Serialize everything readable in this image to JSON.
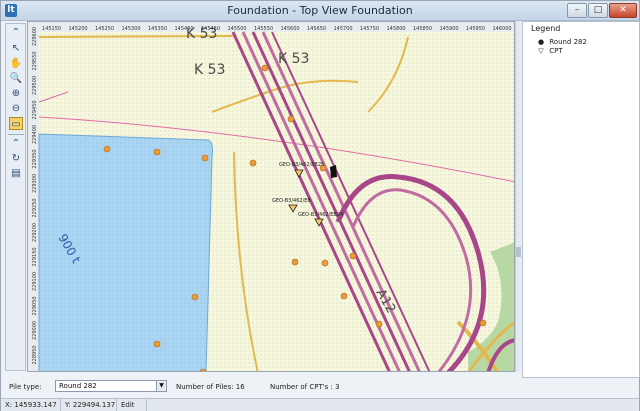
{
  "window": {
    "title": "Foundation - Top View Foundation",
    "app_icon": "app-icon"
  },
  "window_buttons": {
    "minimize": "–",
    "maximize": "□",
    "close": "✕"
  },
  "toolbar": {
    "tools": [
      {
        "name": "collapse-up-icon",
        "glyph": "⌃"
      },
      {
        "name": "select-arrow-icon",
        "glyph": "↖"
      },
      {
        "name": "pan-hand-icon",
        "glyph": "✋"
      },
      {
        "name": "zoom-in-icon",
        "glyph": "🔍"
      },
      {
        "name": "zoom-window-icon",
        "glyph": "⊕"
      },
      {
        "name": "zoom-out-icon",
        "glyph": "⊖"
      },
      {
        "name": "zoom-extent-icon",
        "glyph": "▭"
      },
      {
        "name": "collapse-up-icon-2",
        "glyph": "⌃"
      },
      {
        "name": "redraw-icon",
        "glyph": "↻"
      },
      {
        "name": "properties-icon",
        "glyph": "▤"
      }
    ]
  },
  "ruler_top": [
    "145150",
    "145200",
    "145250",
    "145300",
    "145350",
    "145400",
    "145450",
    "145500",
    "145550",
    "145600",
    "145650",
    "145700",
    "145750",
    "145800",
    "145850",
    "145900",
    "145950",
    "146000"
  ],
  "ruler_left": [
    "229600",
    "229550",
    "229500",
    "229450",
    "229400",
    "229350",
    "229300",
    "229250",
    "229200",
    "229150",
    "229100",
    "229050",
    "229000",
    "228950"
  ],
  "map": {
    "labels": {
      "k53_a": "K 53",
      "k53_b": "K 53",
      "k53_c": "K 53",
      "a12": "A12",
      "water": "900 t"
    },
    "cpt_labels": [
      "GEO-B3/462/EB25",
      "GEO-B3/462/EB",
      "GEO-B3/462/EB24"
    ]
  },
  "legend": {
    "title": "Legend",
    "items": [
      {
        "symbol": "●",
        "label": "Round 282"
      },
      {
        "symbol": "▽",
        "label": "CPT"
      }
    ]
  },
  "bottom": {
    "pile_type_label": "Pile type:",
    "pile_type_value": "Round 282",
    "num_piles": "Number of Piles: 16",
    "num_cpts": "Number of CPT's : 3"
  },
  "status": {
    "x": "X: 145933.147",
    "y": "Y: 229494.137",
    "mode": "Edit"
  }
}
